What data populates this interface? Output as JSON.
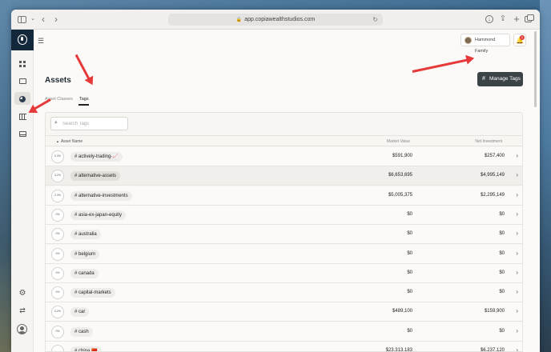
{
  "browser": {
    "url": "app.copiawealthstudios.com"
  },
  "header": {
    "household": "Hammond Family",
    "notification_count": "1"
  },
  "page": {
    "title": "Assets",
    "manage_tags_label": "Manage Tags",
    "tabs": [
      {
        "label": "Asset Classes",
        "active": false
      },
      {
        "label": "Tags",
        "active": true
      }
    ],
    "search_placeholder": "Search Tags"
  },
  "table": {
    "columns": {
      "name": "Asset Name",
      "market_value": "Market Value",
      "net_investment": "Net Investment"
    },
    "rows": [
      {
        "pct": "0.3%",
        "tag": "# actively-trading-📈",
        "market_value": "$591,900",
        "net_investment": "$257,400",
        "highlight": false
      },
      {
        "pct": "3.2%",
        "tag": "# alternative-assets",
        "market_value": "$6,653,695",
        "net_investment": "$4,995,149",
        "highlight": true
      },
      {
        "pct": "2.3%",
        "tag": "# alternative-investments",
        "market_value": "$5,005,375",
        "net_investment": "$2,295,149",
        "highlight": false
      },
      {
        "pct": "0%",
        "tag": "# asia-ex-japan-equity",
        "market_value": "$0",
        "net_investment": "$0",
        "highlight": false
      },
      {
        "pct": "0%",
        "tag": "# australia",
        "market_value": "$0",
        "net_investment": "$0",
        "highlight": false
      },
      {
        "pct": "0%",
        "tag": "# belgium",
        "market_value": "$0",
        "net_investment": "$0",
        "highlight": false
      },
      {
        "pct": "0%",
        "tag": "# canada",
        "market_value": "$0",
        "net_investment": "$0",
        "highlight": false
      },
      {
        "pct": "0%",
        "tag": "# capital-markets",
        "market_value": "$0",
        "net_investment": "$0",
        "highlight": false
      },
      {
        "pct": "0.2%",
        "tag": "# car",
        "market_value": "$489,100",
        "net_investment": "$159,900",
        "highlight": false
      },
      {
        "pct": "0%",
        "tag": "# cash",
        "market_value": "$0",
        "net_investment": "$0",
        "highlight": false
      },
      {
        "pct": "",
        "tag": "# china 🇨🇳",
        "market_value": "$23,313,183",
        "net_investment": "$6,237,120",
        "highlight": false
      }
    ]
  },
  "icons": {
    "sidebar_toggle": "sidebar-icon",
    "back": "chevron-left-icon",
    "forward": "chevron-right-icon",
    "lock": "lock-icon",
    "reload": "reload-icon",
    "download": "download-icon",
    "share": "share-icon",
    "new_tab": "plus-icon",
    "tabs": "tabs-icon",
    "search": "search-icon",
    "bell": "bell-icon",
    "settings": "gear-icon",
    "switch": "swap-icon",
    "profile": "user-icon"
  },
  "colors": {
    "brand_navy": "#14283c",
    "button_dark": "#3c4346",
    "annotation_red": "#e63a3a",
    "badge_red": "#e0403a"
  }
}
